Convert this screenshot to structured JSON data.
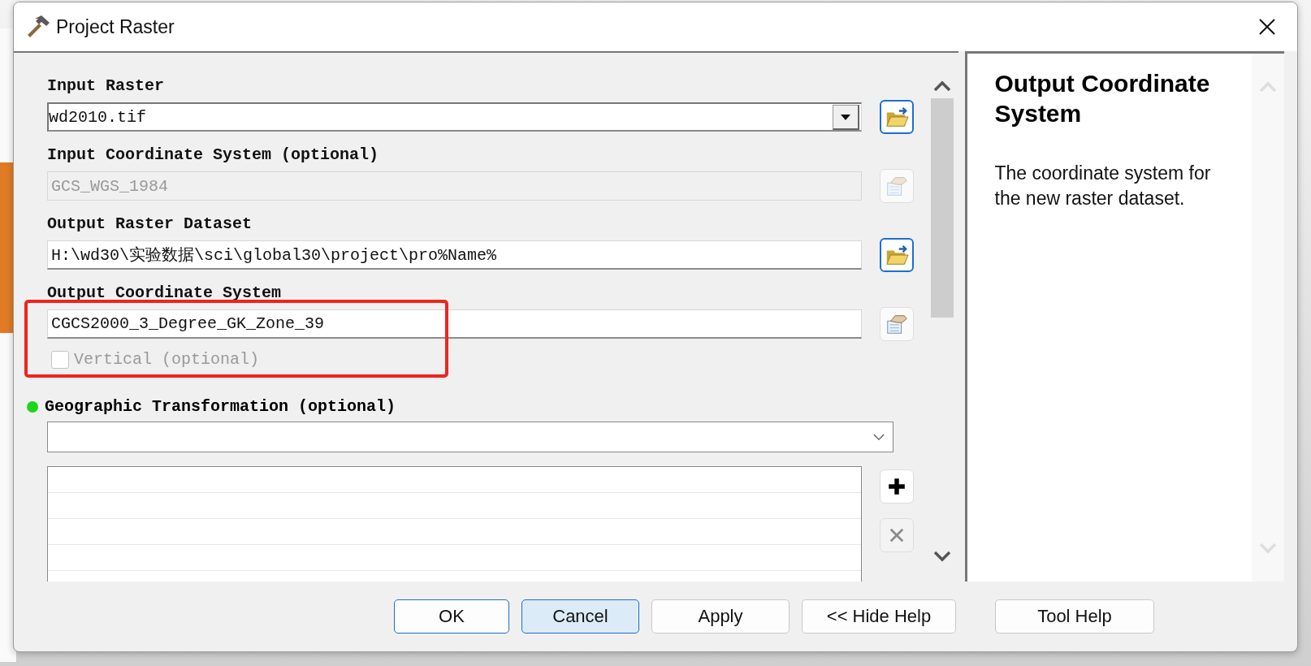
{
  "window": {
    "title": "Project Raster"
  },
  "parameters": [
    {
      "label": "Input Raster",
      "kind": "dropdown",
      "value": "wd2010.tif",
      "disabled": false,
      "button": {
        "kind": "browse"
      }
    },
    {
      "label": "Input Coordinate System (optional)",
      "kind": "text",
      "value": "GCS_WGS_1984",
      "disabled": true,
      "button": {
        "kind": "properties"
      }
    },
    {
      "label": "Output Raster Dataset",
      "kind": "text",
      "value": "H:\\wd30\\实验数据\\sci\\global30\\project\\pro%Name%",
      "disabled": false,
      "button": {
        "kind": "browse"
      }
    },
    {
      "label": "Output Coordinate System",
      "kind": "text",
      "value": "CGCS2000_3_Degree_GK_Zone_39",
      "disabled": false,
      "button": {
        "kind": "properties"
      }
    }
  ],
  "vertical": {
    "label": "Vertical (optional)",
    "checked": false,
    "disabled": true
  },
  "transformation": {
    "label": "Geographic Transformation (optional)",
    "flagged": true,
    "add_disabled": false,
    "remove_disabled": true
  },
  "help": {
    "title": "Output Coordinate System",
    "text": "The coordinate system for the new raster dataset."
  },
  "buttons": [
    {
      "label": "OK",
      "default": true,
      "focused": false
    },
    {
      "label": "Cancel",
      "default": false,
      "focused": true
    },
    {
      "label": "Apply",
      "default": false,
      "focused": false
    },
    {
      "label": "<< Hide Help",
      "default": false,
      "focused": false
    },
    {
      "label": "Tool Help",
      "default": false,
      "focused": false
    }
  ]
}
